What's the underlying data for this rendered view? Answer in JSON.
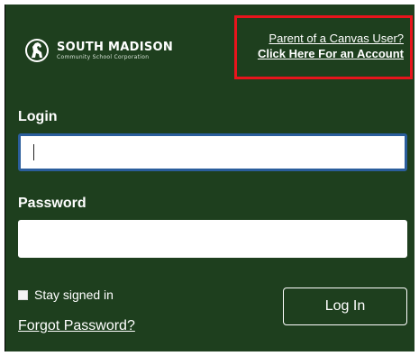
{
  "brand": {
    "icon": "mustang-horse-emblem-icon",
    "name": "SOUTH MADISON",
    "subtitle": "Community School Corporation"
  },
  "parent_link": {
    "line1": "Parent of a Canvas User?",
    "line2": "Click Here For an Account",
    "highlight_color": "#e8141c"
  },
  "form": {
    "login_label": "Login",
    "login_value": "",
    "password_label": "Password",
    "password_value": "",
    "stay_signed_in_label": "Stay signed in",
    "forgot_password_label": "Forgot Password?",
    "submit_label": "Log In"
  },
  "colors": {
    "background": "#1e3f1e",
    "focus_border": "#2b5e9c",
    "text": "#ffffff"
  }
}
